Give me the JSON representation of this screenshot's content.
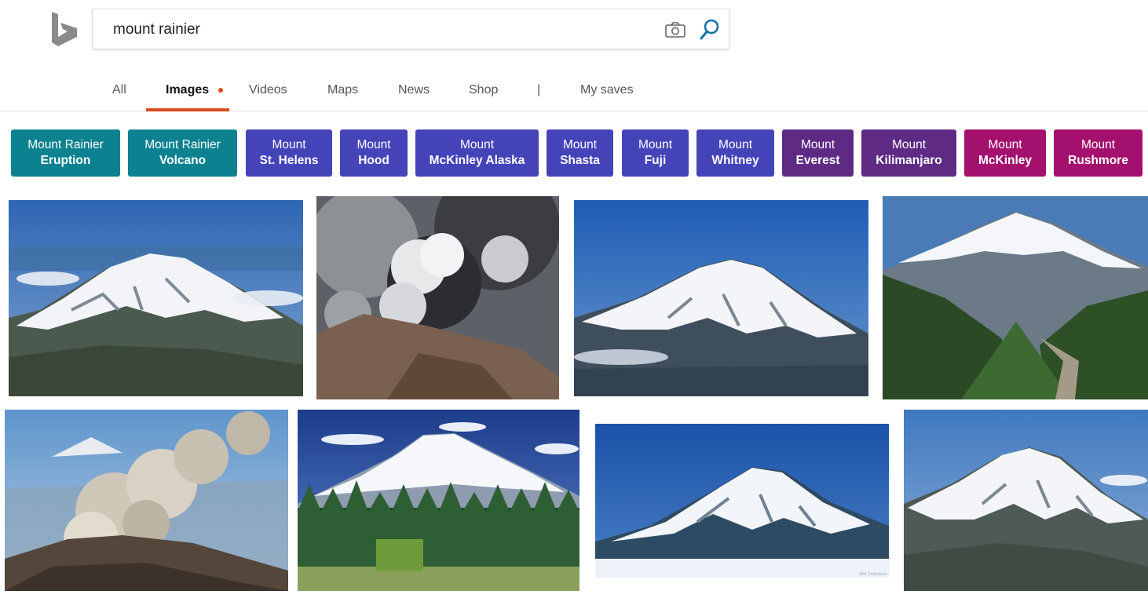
{
  "search": {
    "query": "mount rainier"
  },
  "nav": {
    "items": [
      "All",
      "Images",
      "Videos",
      "Maps",
      "News",
      "Shop",
      "|",
      "My saves"
    ]
  },
  "chips": [
    {
      "line1": "Mount Rainier",
      "line2": "Eruption",
      "color": "#0c8190"
    },
    {
      "line1": "Mount Rainier",
      "line2": "Volcano",
      "color": "#0c8190"
    },
    {
      "line1": "Mount",
      "line2": "St. Helens",
      "color": "#4443b8"
    },
    {
      "line1": "Mount",
      "line2": "Hood",
      "color": "#4443b8"
    },
    {
      "line1": "Mount",
      "line2": "McKinley Alaska",
      "color": "#4443b8"
    },
    {
      "line1": "Mount",
      "line2": "Shasta",
      "color": "#4443b8"
    },
    {
      "line1": "Mount",
      "line2": "Fuji",
      "color": "#4443b8"
    },
    {
      "line1": "Mount",
      "line2": "Whitney",
      "color": "#4443b8"
    },
    {
      "line1": "Mount",
      "line2": "Everest",
      "color": "#5e2a84"
    },
    {
      "line1": "Mount",
      "line2": "Kilimanjaro",
      "color": "#5e2a84"
    },
    {
      "line1": "Mount",
      "line2": "McKinley",
      "color": "#a3106e"
    },
    {
      "line1": "Mount",
      "line2": "Rushmore",
      "color": "#a3106e"
    }
  ],
  "images": {
    "watermark_text": "AWI Collection",
    "tiles": [
      {
        "subject": "snow-capped-peak-aerial"
      },
      {
        "subject": "volcanic-ash-plume"
      },
      {
        "subject": "snow-capped-peak-blue-sky"
      },
      {
        "subject": "peak-above-forest-valley"
      },
      {
        "subject": "eruption-smoke-cloud"
      },
      {
        "subject": "peak-behind-pine-forest"
      },
      {
        "subject": "snowy-peak-above-clouds"
      },
      {
        "subject": "snow-capped-peak-aerial-2"
      }
    ]
  },
  "colors": {
    "accent": "#de4a1d",
    "search_icon": "#1a73a8",
    "teal_chip": "#0c8190",
    "indigo_chip": "#4443b8",
    "purple_chip": "#5e2a84",
    "magenta_chip": "#a3106e"
  }
}
